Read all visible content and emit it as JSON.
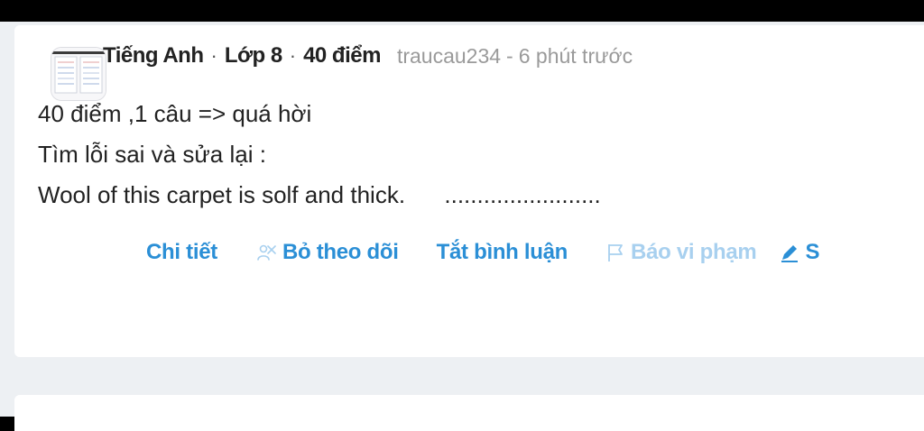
{
  "question": {
    "subject": "Tiếng Anh",
    "grade": "Lớp 8",
    "points": "40 điểm",
    "separator": "·",
    "author": "traucau234",
    "author_time_separator": "-",
    "time": "6 phút trước",
    "lines": [
      "40 điểm ,1 câu => quá hời",
      "Tìm lỗi sai và sửa lại :",
      "Wool of this carpet is solf and thick.      ........................"
    ]
  },
  "actions": {
    "detail": "Chi tiết",
    "unfollow": "Bỏ theo dõi",
    "disable_comments": "Tắt bình luận",
    "report": "Báo vi phạm",
    "edit_partial": "S"
  },
  "icons": {
    "unfollow": "unfollow-icon",
    "report": "flag-icon",
    "edit": "pencil-icon"
  },
  "colors": {
    "accent": "#2b8fd6",
    "accent_muted": "#a8d0ef",
    "text": "#222222",
    "meta_text": "#9a9a9a",
    "page_background": "#edf0f3",
    "card_background": "#ffffff"
  }
}
